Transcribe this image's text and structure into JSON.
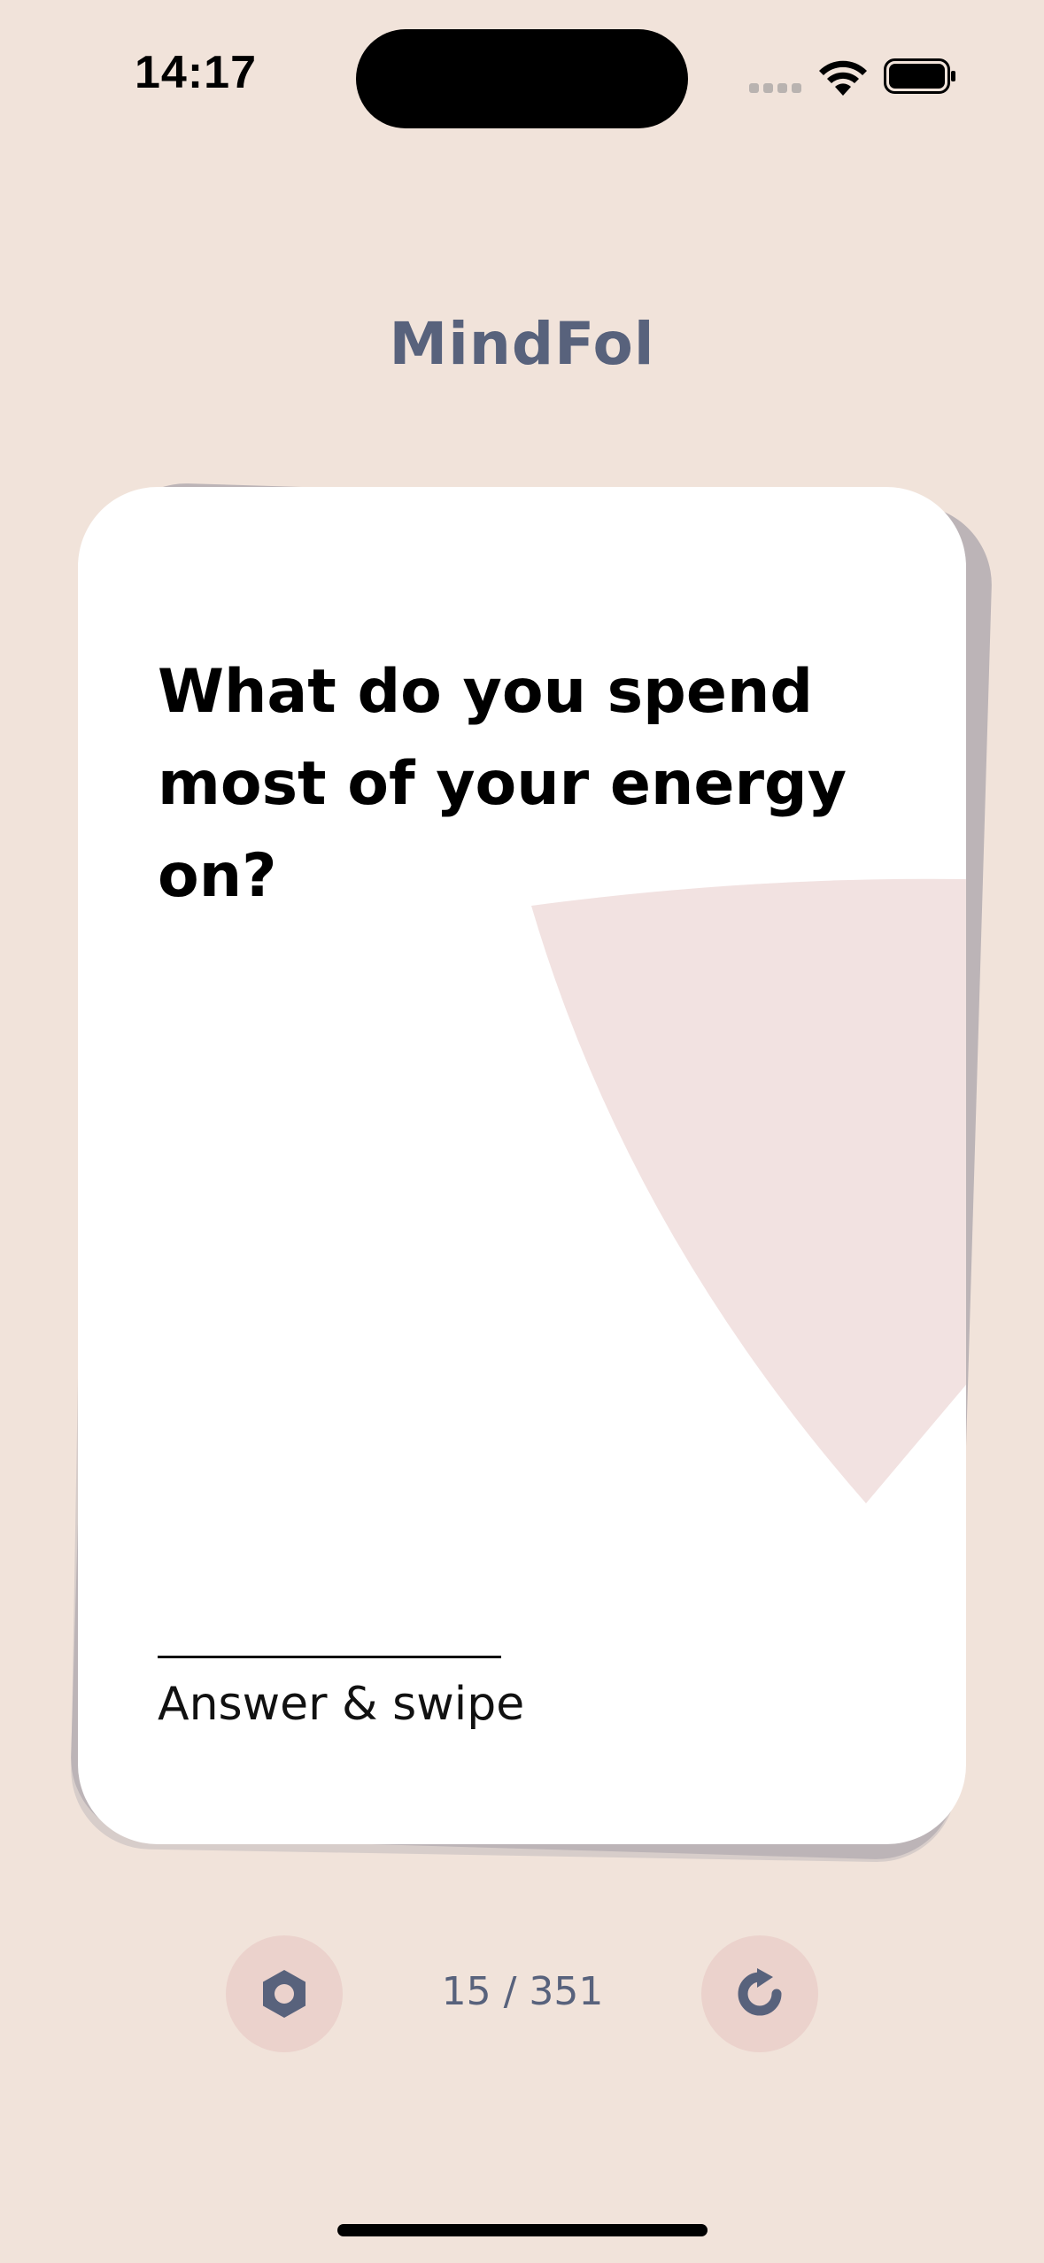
{
  "status_bar": {
    "time": "14:17",
    "icons": [
      "cellular-signal-icon",
      "wifi-icon",
      "battery-icon"
    ]
  },
  "app": {
    "logo_text": "MindFol"
  },
  "card": {
    "question": "What do you spend most of your energy on?",
    "hint": "Answer & swipe"
  },
  "controls": {
    "left_icon": "hexagon-settings-icon",
    "counter": "15 / 351",
    "right_icon": "refresh-icon"
  },
  "colors": {
    "background": "#f1e3da",
    "accent": "#58627c",
    "button_bg": "#ebd2cc",
    "decor": "#f2e2e1"
  }
}
